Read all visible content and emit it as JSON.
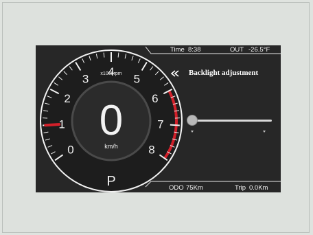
{
  "status_bar": {
    "time_label": "Time",
    "time_value": "8:38",
    "out_label": "OUT",
    "out_value": "-26.5°F"
  },
  "tachometer": {
    "unit": "x1000rpm",
    "ticks": [
      "0",
      "1",
      "2",
      "3",
      "4",
      "5",
      "6",
      "7",
      "8"
    ],
    "redline_start": 6,
    "needle_value": 1
  },
  "speed": {
    "value": "0",
    "unit": "km/h"
  },
  "gear": "P",
  "backlight": {
    "back_icon": "double-chevron-left-icon",
    "title": "Backlight adjustment",
    "level": 0
  },
  "bottom_bar": {
    "odo_label": "ODO",
    "odo_value": "75Km",
    "trip_label": "Trip",
    "trip_value": "0.0Km"
  },
  "colors": {
    "panel_bg": "#272727",
    "redline": "#d2202a",
    "needle": "#d2202a"
  }
}
